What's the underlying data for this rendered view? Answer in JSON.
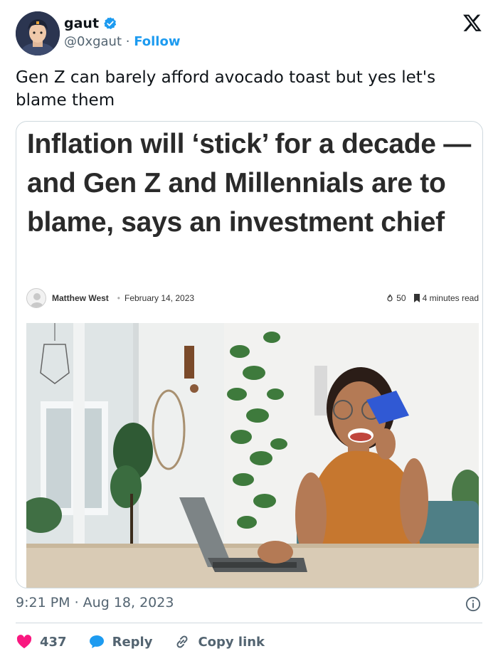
{
  "author": {
    "name": "gaut",
    "handle": "@0xgaut",
    "separator": " · ",
    "follow_label": "Follow"
  },
  "tweet": {
    "text": "Gen Z can barely afford avocado toast but yes let's blame them"
  },
  "article": {
    "headline": "Inflation will ‘stick’ for a decade — and Gen Z and Millennials are to blame, says an investment chief",
    "author": "Matthew West",
    "date": "February 14, 2023",
    "likes": "50",
    "read_time": "4 minutes read"
  },
  "timestamp": "9:21 PM · Aug 18, 2023",
  "actions": {
    "like_count": "437",
    "reply_label": "Reply",
    "copy_label": "Copy link"
  },
  "colors": {
    "accent": "#1d9bf0",
    "like": "#f91880",
    "muted": "#536471",
    "text": "#0f1419"
  },
  "icons": [
    "verified-badge-icon",
    "x-logo-icon",
    "info-icon",
    "heart-icon",
    "reply-icon",
    "link-icon",
    "flame-icon",
    "bookmark-icon"
  ]
}
